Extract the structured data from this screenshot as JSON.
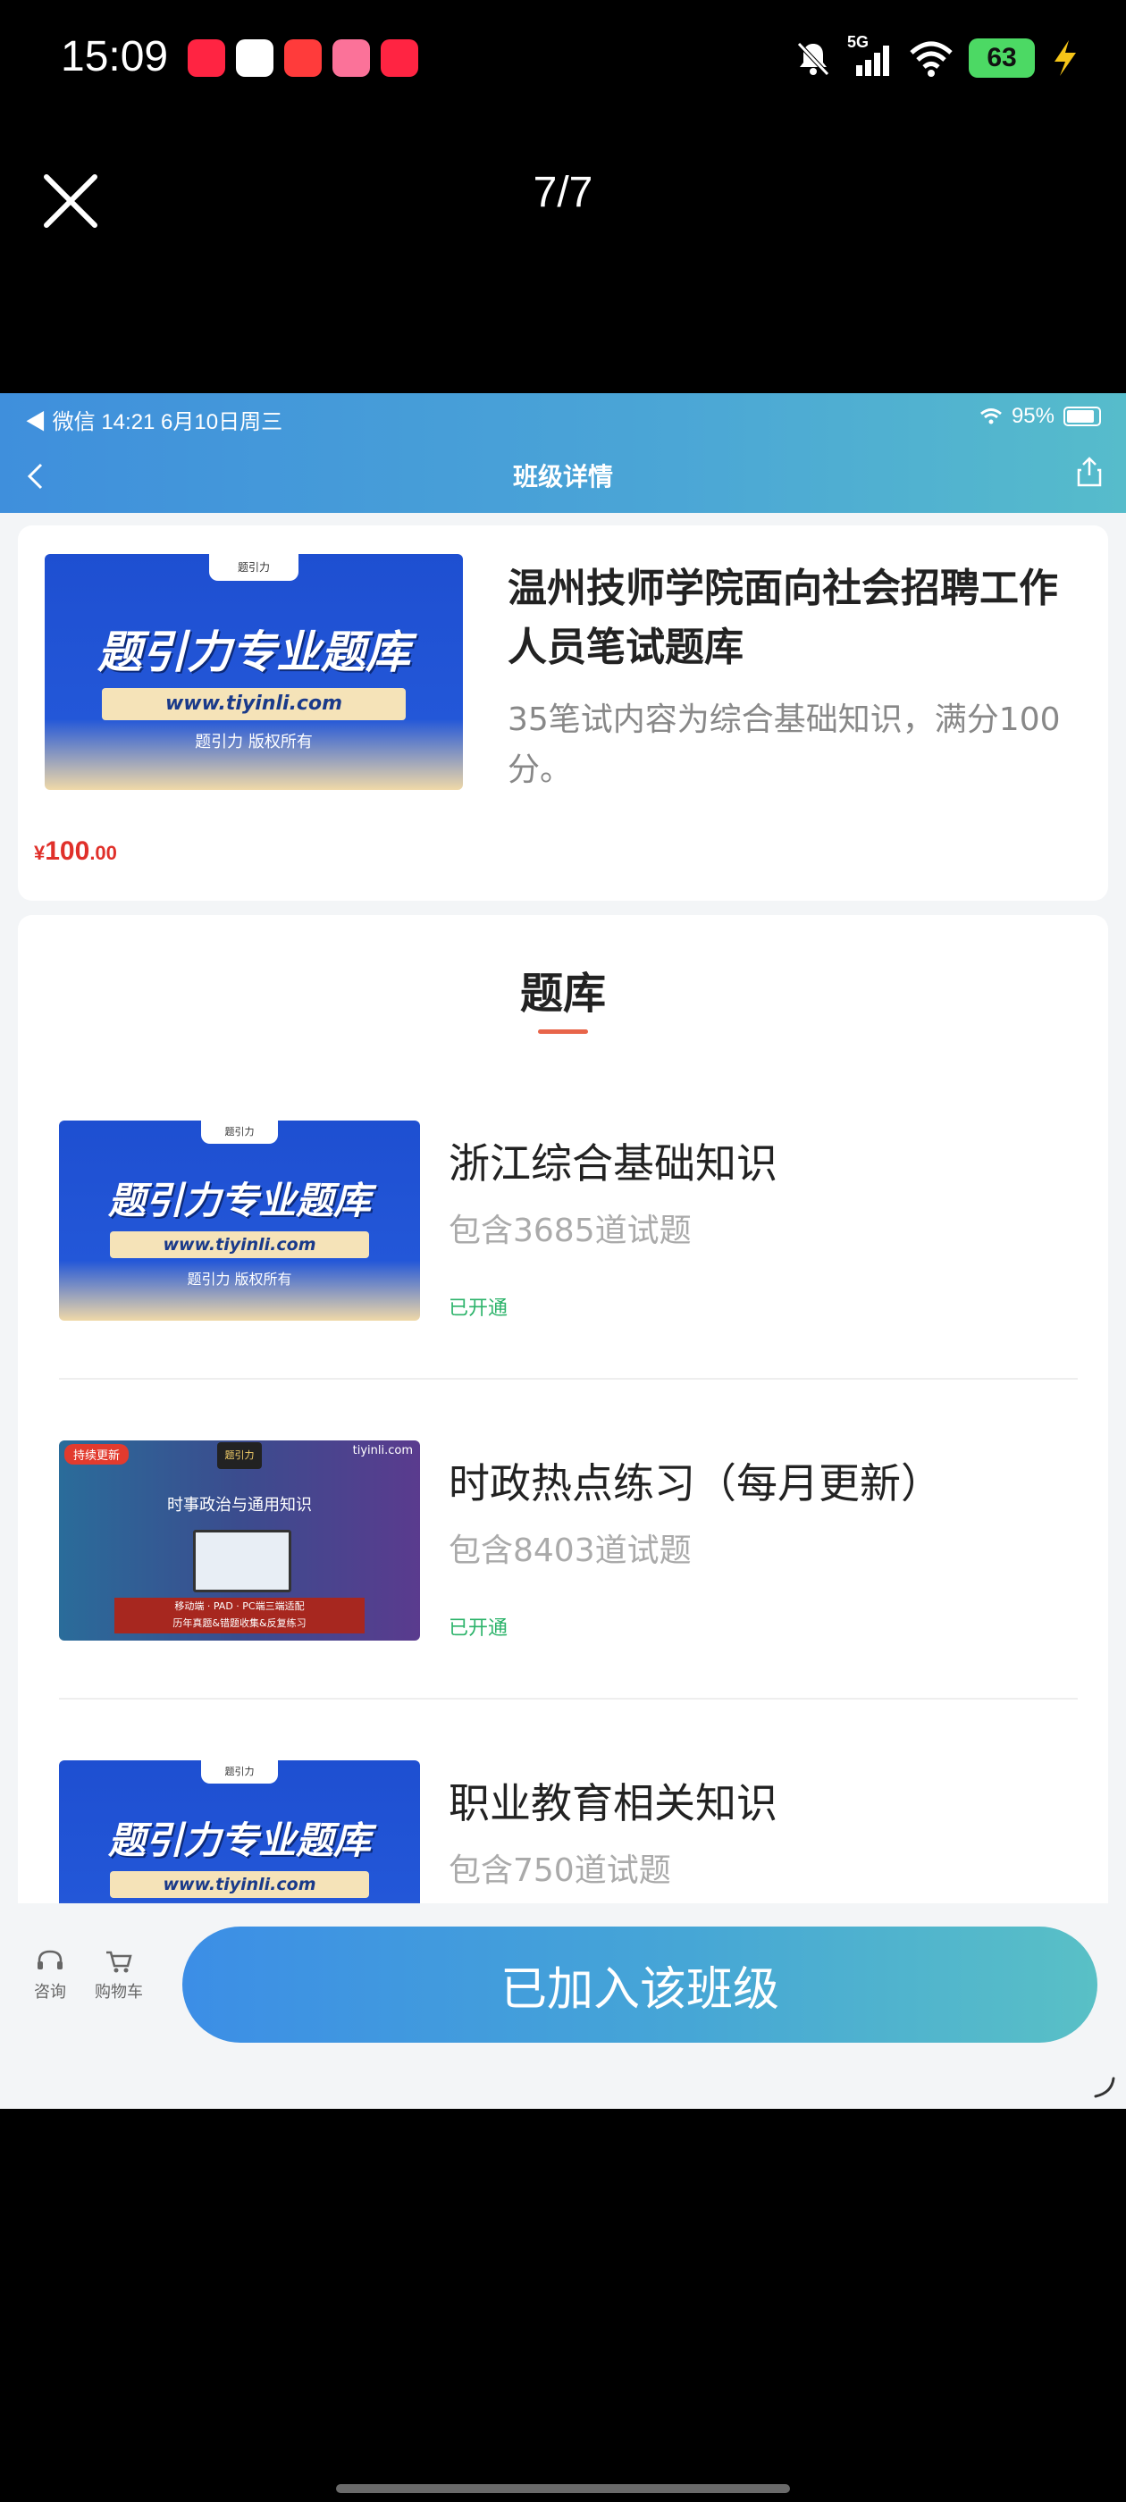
{
  "status_bar": {
    "time": "15:09",
    "network": "5G",
    "battery": "63",
    "app_icons": [
      {
        "name": "xiaohongshu-icon",
        "label": "小红书",
        "color": "#ff2442"
      },
      {
        "name": "qq-icon",
        "label": "",
        "color": "#ffffff"
      },
      {
        "name": "app-red-icon",
        "label": "",
        "color": "#ff3b3b"
      },
      {
        "name": "bilibili-icon",
        "label": "bilibili",
        "color": "#fb7299"
      },
      {
        "name": "xiaohongshu-icon-2",
        "label": "小红书",
        "color": "#ff2442"
      }
    ]
  },
  "viewer": {
    "counter": "7/7"
  },
  "inner": {
    "status_left": "◀ 微信   14:21   6月10日周三",
    "status_right": "95%",
    "header_title": "班级详情",
    "course": {
      "thumb_title": "题引力专业题库",
      "thumb_url": "www.tiyinli.com",
      "thumb_copy": "题引力 版权所有",
      "thumb_logo": "题引力",
      "title": "温州技师学院面向社会招聘工作人员笔试题库",
      "desc": "35笔试内容为综合基础知识，满分100分。",
      "price_currency": "¥",
      "price_int": "100",
      "price_dec": ".00"
    },
    "section_title": "题库",
    "items": [
      {
        "name": "浙江综合基础知识",
        "count": "包含3685道试题",
        "status": "已开通",
        "thumb_title": "题引力专业题库",
        "thumb_url": "www.tiyinli.com",
        "thumb_copy": "题引力 版权所有",
        "thumb_logo": "题引力"
      },
      {
        "name": "时政热点练习（每月更新）",
        "count": "包含8403道试题",
        "status": "已开通",
        "thumb_badge": "持续更新",
        "thumb_site": "tiyinli.com",
        "thumb_logo": "题引力",
        "thumb_heading": "时事政治与通用知识",
        "thumb_banner1": "移动端 · PAD · PC端三端适配",
        "thumb_banner2": "历年真题&错题收集&反复练习"
      },
      {
        "name": "职业教育相关知识",
        "count": "包含750道试题",
        "thumb_title": "题引力专业题库",
        "thumb_url": "www.tiyinli.com",
        "thumb_logo": "题引力"
      }
    ],
    "bottom": {
      "consult_label": "咨询",
      "cart_label": "购物车",
      "joined_label": "已加入该班级"
    }
  },
  "colors": {
    "price": "#e0302a",
    "status_open": "#2cb36a",
    "accent_underline": "#e8654a",
    "header_start": "#3f8fdc",
    "header_end": "#56bccb"
  }
}
